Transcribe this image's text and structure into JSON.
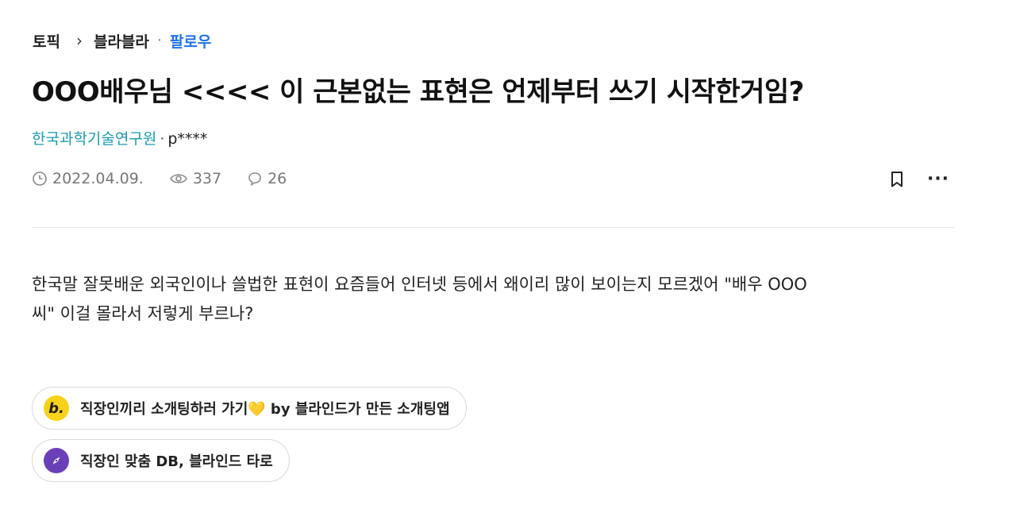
{
  "breadcrumb": {
    "topic": "토픽",
    "separator": "›",
    "channel": "블라블라",
    "dot": "·",
    "follow": "팔로우"
  },
  "post": {
    "title": "OOO배우님 <<<< 이 근본없는 표현은 언제부터 쓰기 시작한거임?",
    "company": "한국과학기술연구원",
    "author_sep": "·",
    "nickname": "p****",
    "date": "2022.04.09.",
    "views": "337",
    "comments": "26",
    "more": "···",
    "body_line1": "한국말 잘못배운 외국인이나 쓸법한 표현이 요즘들어 인터넷 등에서 왜이리 많이 보이는지 모르겠어 \"배우 OOO",
    "body_line2": "씨\" 이걸 몰라서 저렇게 부르나?"
  },
  "promos": [
    {
      "icon": "blind-b-icon",
      "icon_text": "b.",
      "label": "직장인끼리 소개팅하러 가기💛 by 블라인드가 만든 소개팅앱",
      "color": "#f8d21a"
    },
    {
      "icon": "compass-icon",
      "label": "직장인 맞춤 DB, 블라인드 타로",
      "color": "#6a3fb8"
    }
  ]
}
